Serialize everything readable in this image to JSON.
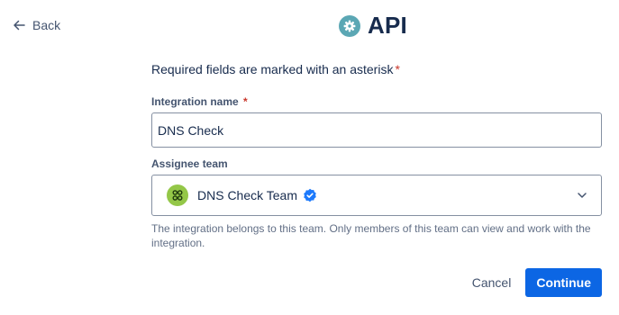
{
  "nav": {
    "back_label": "Back"
  },
  "header": {
    "title": "API",
    "logo_icon": "gear-icon"
  },
  "form": {
    "required_note": "Required fields are marked with an asterisk",
    "asterisk": "*",
    "integration_name": {
      "label": "Integration name",
      "value": "DNS Check"
    },
    "assignee_team": {
      "label": "Assignee team",
      "selected": "DNS Check Team",
      "verified": true
    },
    "helper_text": "The integration belongs to this team. Only members of this team can view and work with the integration."
  },
  "actions": {
    "cancel_label": "Cancel",
    "continue_label": "Continue"
  },
  "colors": {
    "primary": "#0c66e4",
    "required": "#c9372c",
    "api_logo": "#5ba7b4",
    "team_avatar": "#94c748",
    "verified": "#1d7afc"
  }
}
